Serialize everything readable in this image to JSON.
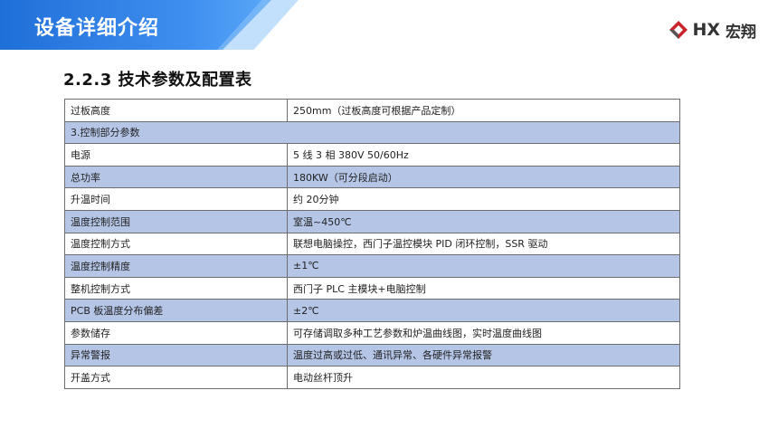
{
  "header": {
    "title": "设备详细介绍",
    "logo_brand": "HX",
    "logo_cn": "宏翔",
    "accent_color": "#2f7fe6"
  },
  "section_title": "2.2.3 技术参数及配置表",
  "table": {
    "row_shade_color": "#b5c5e6",
    "rows": [
      {
        "label": "过板高度",
        "value": "250mm（过板高度可根据产品定制）",
        "shaded": false
      },
      {
        "label": "3.控制部分参数",
        "value": "",
        "shaded": true,
        "span": true
      },
      {
        "label": "电源",
        "value": "5 线 3 相 380V 50/60Hz",
        "shaded": false
      },
      {
        "label": "总功率",
        "value": "180KW（可分段启动）",
        "shaded": true
      },
      {
        "label": "升温时间",
        "value": "约 20分钟",
        "shaded": false
      },
      {
        "label": "温度控制范围",
        "value": "室温~450℃",
        "shaded": true
      },
      {
        "label": "温度控制方式",
        "value": "联想电脑操控，西门子温控模块 PID 闭环控制，SSR 驱动",
        "shaded": false
      },
      {
        "label": "温度控制精度",
        "value": "±1℃",
        "shaded": true
      },
      {
        "label": "整机控制方式",
        "value": "西门子 PLC 主模块+电脑控制",
        "shaded": false
      },
      {
        "label": "PCB 板温度分布偏差",
        "value": "±2℃",
        "shaded": true
      },
      {
        "label": "参数储存",
        "value": "可存储调取多种工艺参数和炉温曲线图，实时温度曲线图",
        "shaded": false
      },
      {
        "label": "异常警报",
        "value": "温度过高或过低、通讯异常、各硬件异常报警",
        "shaded": true
      },
      {
        "label": "开盖方式",
        "value": "电动丝杆顶升",
        "shaded": false
      }
    ]
  }
}
